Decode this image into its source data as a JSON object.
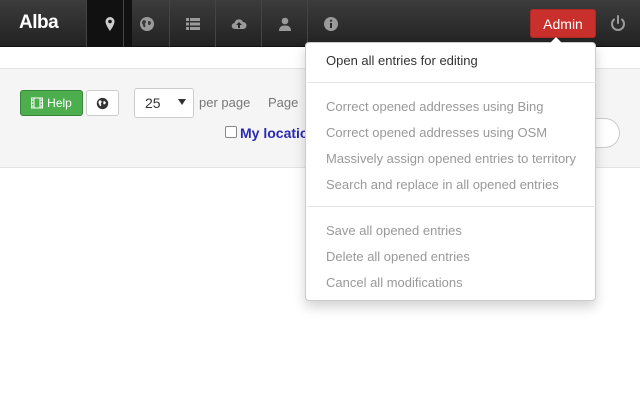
{
  "navbar": {
    "brand": "Alba",
    "icons": [
      "map-marker-icon",
      "globe-icon",
      "list-icon",
      "cloud-upload-icon",
      "user-icon",
      "info-icon"
    ],
    "admin_label": "Admin",
    "power_icon": "power-icon"
  },
  "toolbar": {
    "help_label": "Help",
    "help_icon": "film-icon",
    "globe_icon": "globe-icon",
    "page_size": "25",
    "per_page_label": "per page",
    "page_label": "Page",
    "my_location_label": "My locatio"
  },
  "dropdown": {
    "items": [
      {
        "label": "Open all entries for editing",
        "enabled": true
      },
      {
        "label": "Correct opened addresses using Bing",
        "enabled": false
      },
      {
        "label": "Correct opened addresses using OSM",
        "enabled": false
      },
      {
        "label": "Massively assign opened entries to territory",
        "enabled": false
      },
      {
        "label": "Search and replace in all opened entries",
        "enabled": false
      },
      {
        "label": "Save all opened entries",
        "enabled": false
      },
      {
        "label": "Delete all opened entries",
        "enabled": false
      },
      {
        "label": "Cancel all modifications",
        "enabled": false
      }
    ]
  },
  "colors": {
    "navbar": "#2a2a2a",
    "admin": "#c9302c",
    "help": "#4cae4c",
    "link": "#2a2ab0"
  }
}
